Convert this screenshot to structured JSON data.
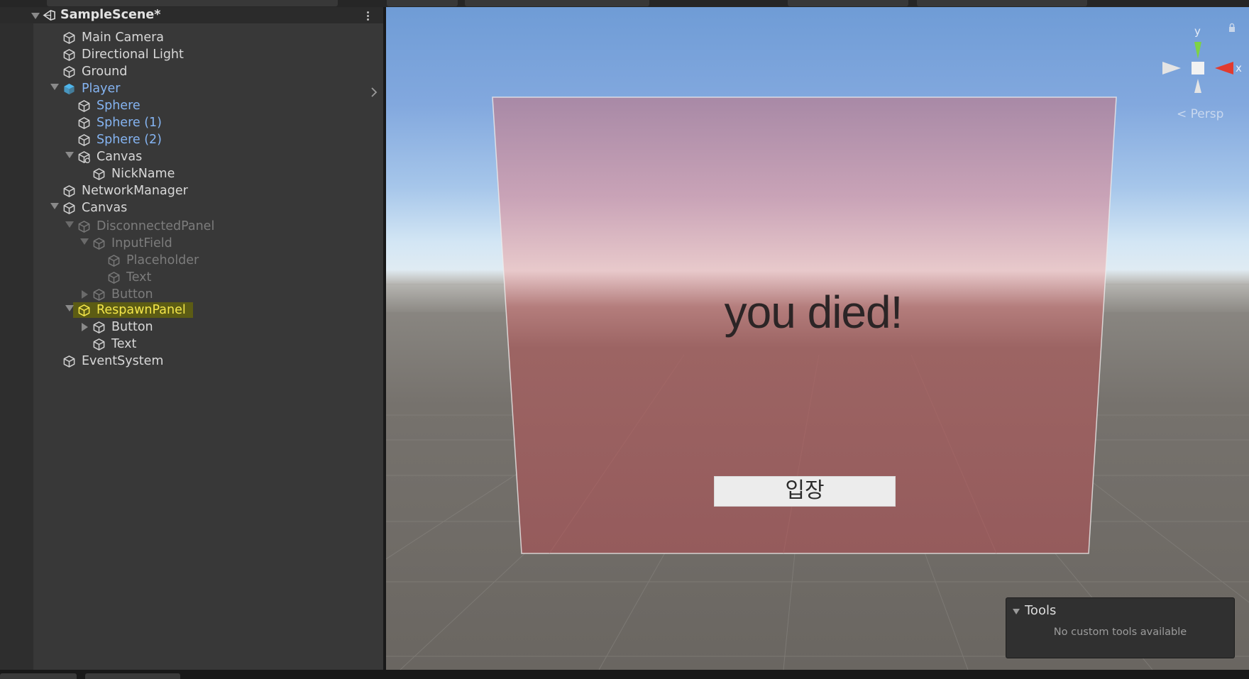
{
  "hierarchy": {
    "scene_name": "SampleScene*",
    "items": [
      {
        "label": "Main Camera"
      },
      {
        "label": "Directional Light"
      },
      {
        "label": "Ground"
      },
      {
        "label": "Player"
      },
      {
        "label": "Sphere"
      },
      {
        "label": "Sphere (1)"
      },
      {
        "label": "Sphere (2)"
      },
      {
        "label": "Canvas"
      },
      {
        "label": "NickName"
      },
      {
        "label": "NetworkManager"
      },
      {
        "label": "Canvas"
      },
      {
        "label": "DisconnectedPanel"
      },
      {
        "label": "InputField"
      },
      {
        "label": "Placeholder"
      },
      {
        "label": "Text"
      },
      {
        "label": "Button"
      },
      {
        "label": "RespawnPanel"
      },
      {
        "label": "Button"
      },
      {
        "label": "Text"
      },
      {
        "label": "EventSystem"
      }
    ]
  },
  "scene_view": {
    "panel_text": "you died!",
    "button_label": "입장",
    "gizmo": {
      "y_label": "y",
      "x_label": "x",
      "persp_label": "< Persp"
    },
    "tools": {
      "title": "Tools",
      "empty_text": "No custom tools available"
    }
  },
  "colors": {
    "selected_blue": "#85b4f2",
    "highlight_yellow": "#f4e64a",
    "panel_tint": "#c87878"
  },
  "icons": [
    "unity-scene-icon",
    "gameobject-cube-icon",
    "prefab-cube-icon",
    "canvas-cube-icon",
    "kebab-menu-icon",
    "chevron-right-icon",
    "lock-icon",
    "axis-gizmo-icon"
  ]
}
